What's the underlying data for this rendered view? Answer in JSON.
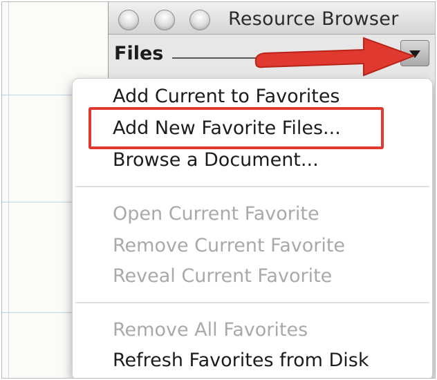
{
  "window": {
    "title": "Resource Browser"
  },
  "toolbar": {
    "section_label": "Files",
    "dropdown_icon": "triangle-down-icon"
  },
  "menu": {
    "items": [
      {
        "label": "Add Current to Favorites",
        "enabled": true
      },
      {
        "label": "Add New Favorite Files...",
        "enabled": true,
        "highlighted": true
      },
      {
        "label": "Browse a Document...",
        "enabled": true
      },
      {
        "label": "Open Current Favorite",
        "enabled": false
      },
      {
        "label": "Remove Current Favorite",
        "enabled": false
      },
      {
        "label": "Reveal Current Favorite",
        "enabled": false
      },
      {
        "label": "Remove All Favorites",
        "enabled": false
      },
      {
        "label": "Refresh Favorites from Disk",
        "enabled": true
      }
    ]
  },
  "annotations": {
    "arrow_color": "#e03a30",
    "highlight_color": "#e03a30"
  }
}
